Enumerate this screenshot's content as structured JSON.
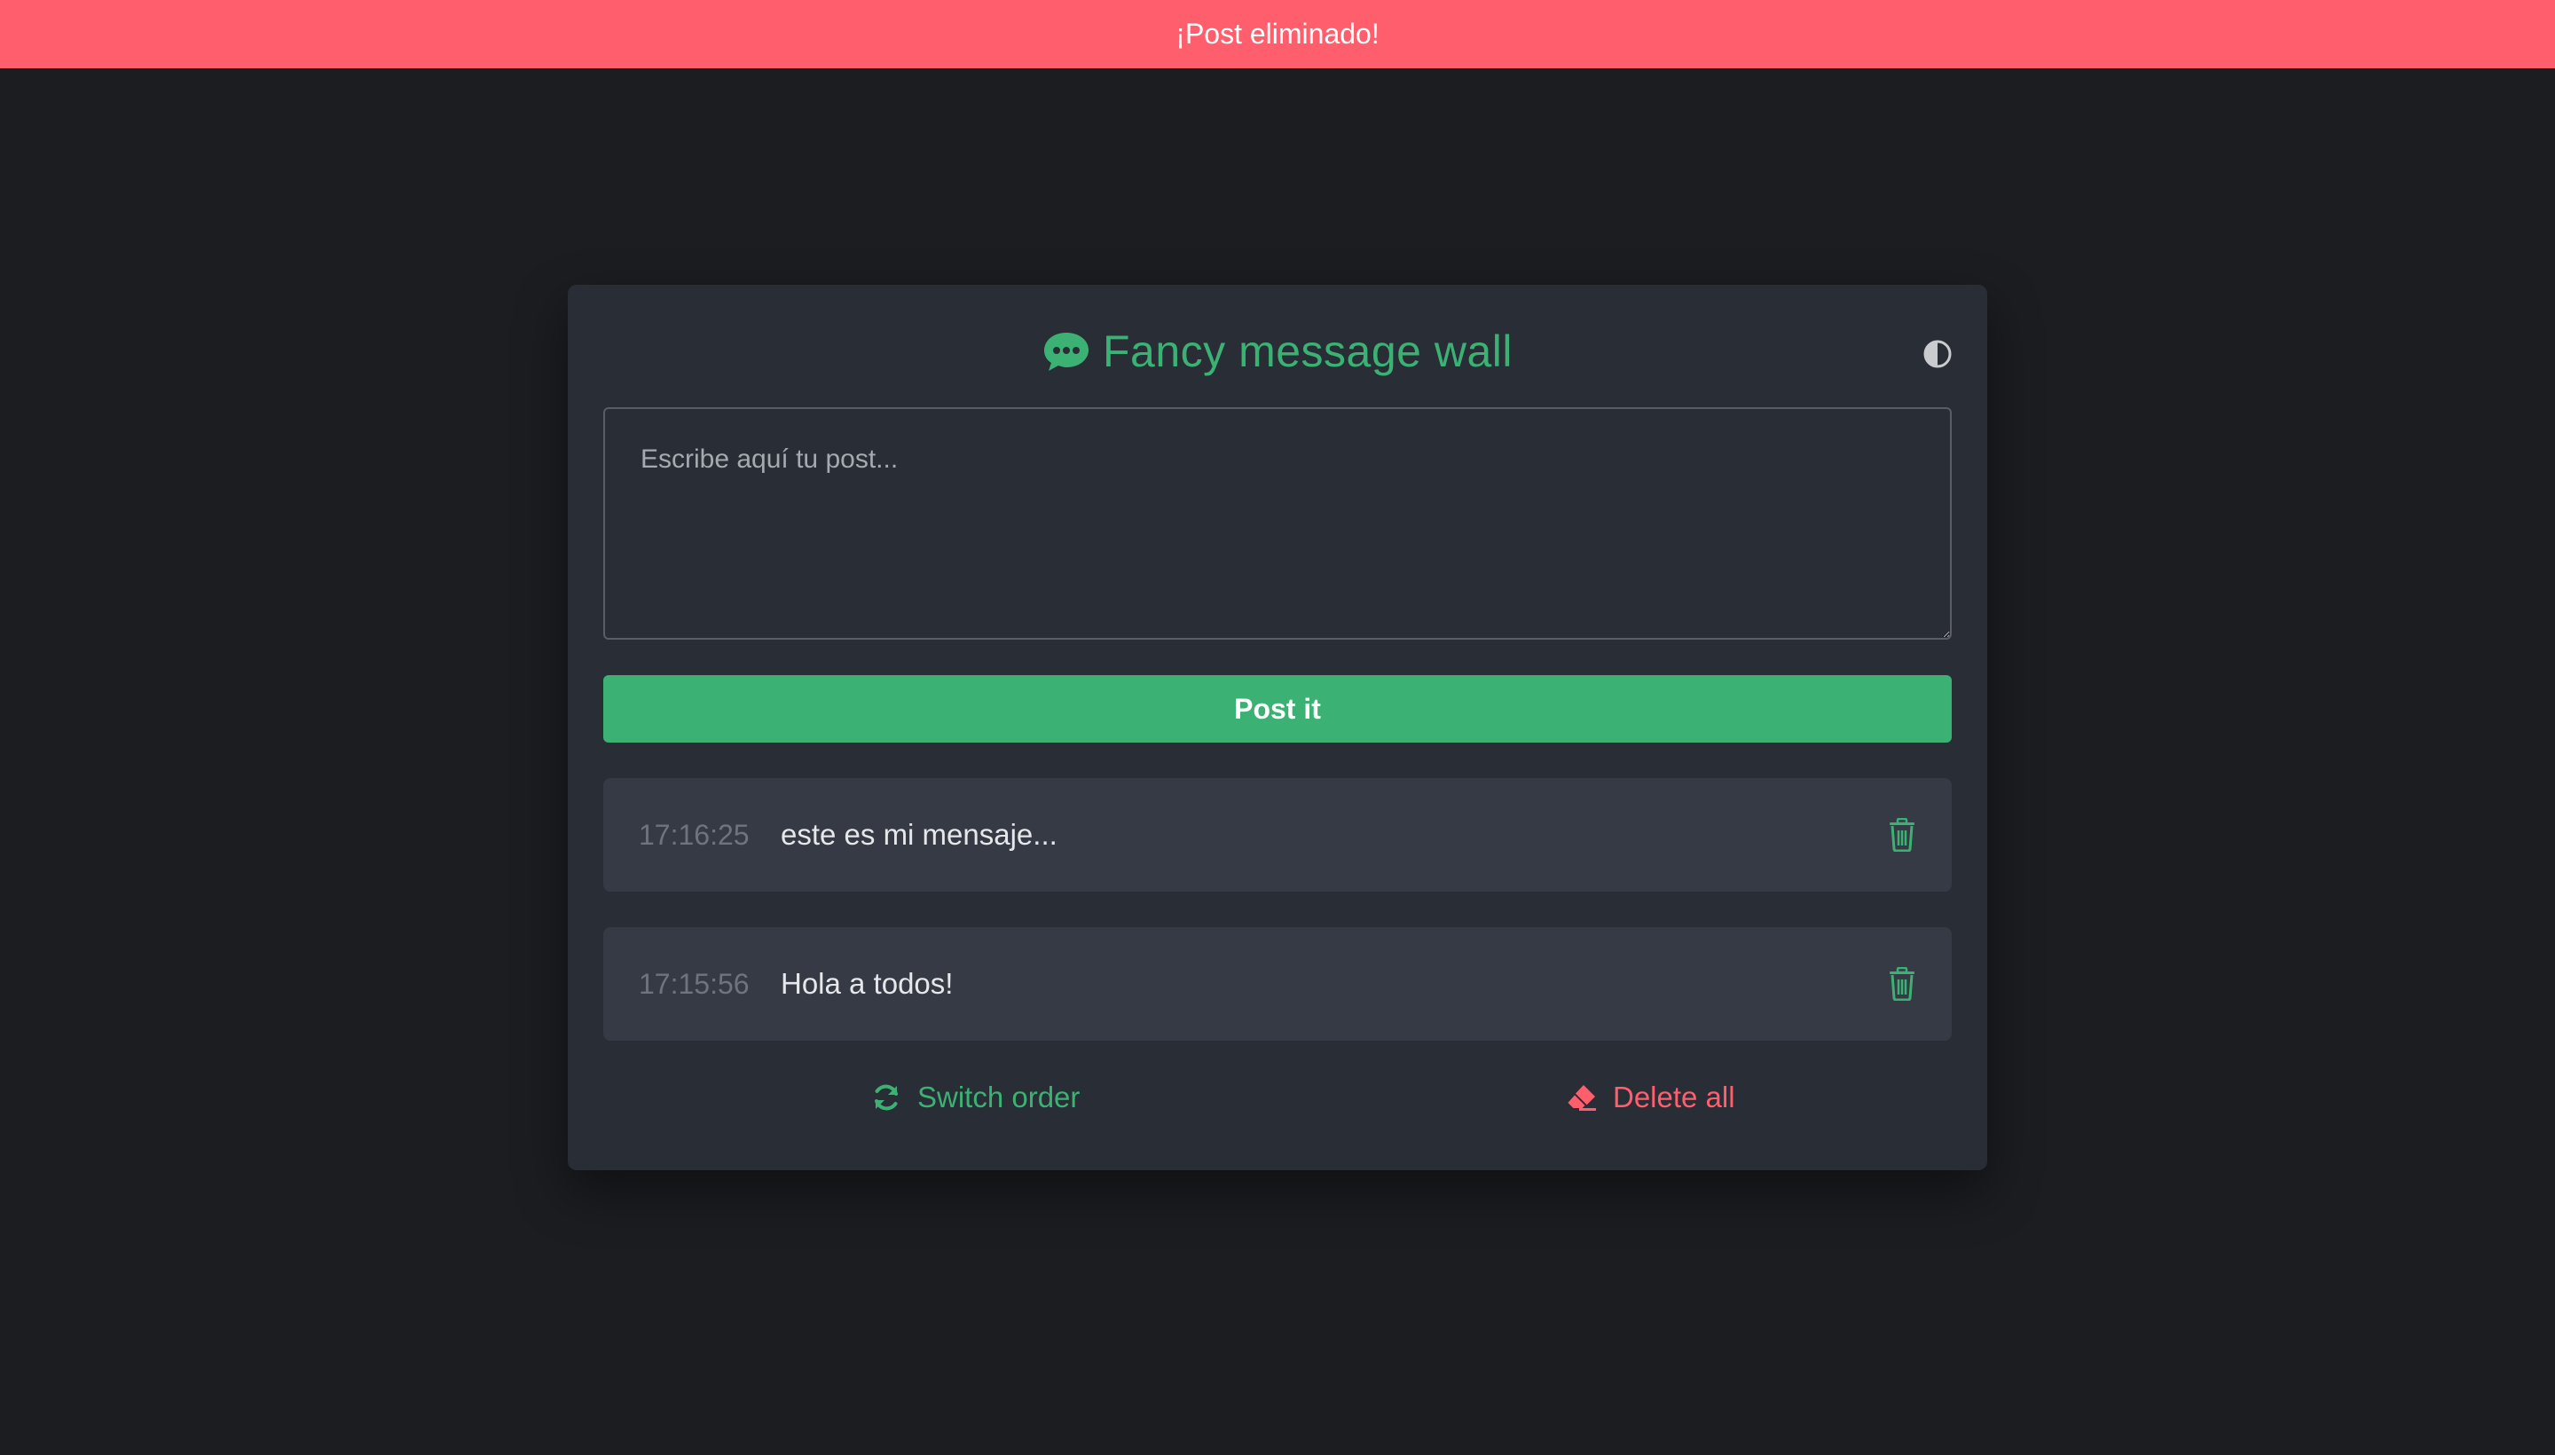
{
  "toast": {
    "message": "¡Post eliminado!",
    "color": "#ff5f6d"
  },
  "app": {
    "title": "Fancy message wall",
    "title_icon": "comment-dots-icon",
    "theme_toggle_icon": "contrast-half-circle-icon",
    "accent_color": "#3bb273",
    "danger_color": "#ff5f6d"
  },
  "composer": {
    "placeholder": "Escribe aquí tu post...",
    "value": "",
    "submit_label": "Post it"
  },
  "posts": [
    {
      "time": "17:16:25",
      "text": "este es mi mensaje...",
      "delete_icon": "trash-icon"
    },
    {
      "time": "17:15:56",
      "text": "Hola a todos!",
      "delete_icon": "trash-icon"
    }
  ],
  "footer": {
    "switch_order_label": "Switch order",
    "switch_order_icon": "sync-arrows-icon",
    "delete_all_label": "Delete all",
    "delete_all_icon": "eraser-icon"
  }
}
